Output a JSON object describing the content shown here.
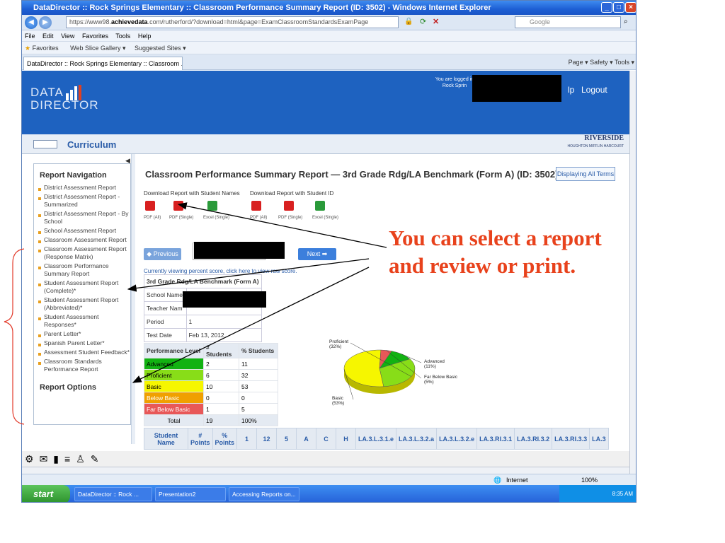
{
  "window": {
    "title": "DataDirector :: Rock Springs Elementary :: Classroom Performance Summary Report (ID: 3502) - Windows Internet Explorer",
    "address_host": "https://www98.",
    "address_bold": "achievedata",
    "address_rest": ".com/rutherford/?download=html&page=ExamClassroomStandardsExamPage",
    "search_placeholder": "Google",
    "menu": [
      "File",
      "Edit",
      "View",
      "Favorites",
      "Tools",
      "Help"
    ],
    "favorites_bar": [
      "Favorites",
      "Web Slice Gallery ▾",
      "Suggested Sites ▾"
    ],
    "tab_title": "DataDirector :: Rock Springs Elementary :: Classroom ...",
    "command_bar": "Page ▾   Safety ▾   Tools ▾"
  },
  "header": {
    "logo_line1": "DATA",
    "logo_line2": "DIRECTOR",
    "logged_in_line1": "You are logged in",
    "logged_in_line2": "Rock Sprin",
    "help_fragment": "lp",
    "logout": "Logout"
  },
  "section_bar": {
    "label": "Curriculum",
    "brand_name": "RIVERSIDE",
    "brand_sub": "HOUGHTON MIFFLIN HARCOURT"
  },
  "sidebar": {
    "heading": "Report Navigation",
    "items": [
      "District Assessment Report",
      "District Assessment Report - Summarized",
      "District Assessment Report - By School",
      "School Assessment Report",
      "Classroom Assessment Report",
      "Classroom Assessment Report (Response Matrix)",
      "Classroom Performance Summary Report",
      "Student Assessment Report (Complete)*",
      "Student Assessment Report (Abbreviated)*",
      "Student Assessment Responses*",
      "Parent Letter*",
      "Spanish Parent Letter*",
      "Assessment Student Feedback*",
      "Classroom Standards Performance Report"
    ],
    "options_heading": "Report Options"
  },
  "report": {
    "title": "Classroom Performance Summary Report — 3rd Grade Rdg/LA Benchmark (Form A) (ID: 3502)",
    "displaying_all_terms": "Displaying All Terms",
    "download_names": "Download Report with Student Names",
    "download_ids": "Download Report with Student ID",
    "icon_labels": [
      "PDF (All)",
      "PDF (Single)",
      "Excel (Single)",
      "PDF (All)",
      "PDF (Single)",
      "Excel (Single)"
    ],
    "previous": "Previous",
    "next": "Next",
    "viewing_text": "Currently viewing percent score, click here to view raw score.",
    "info": {
      "exam_name": "3rd Grade Rdg/LA Benchmark (Form A)",
      "school_label": "School Name",
      "teacher_label": "Teacher Nam",
      "period_label": "Period",
      "period_value": "1",
      "date_label": "Test Date",
      "date_value": "Feb 13, 2012"
    },
    "perf_headers": [
      "Performance Level",
      "# Students",
      "% Students"
    ],
    "perf_rows": [
      {
        "level": "Advanced",
        "count": "2",
        "pct": "11",
        "color": "#12b212"
      },
      {
        "level": "Proficient",
        "count": "6",
        "pct": "32",
        "color": "#88dd18"
      },
      {
        "level": "Basic",
        "count": "10",
        "pct": "53",
        "color": "#f6f600"
      },
      {
        "level": "Below Basic",
        "count": "0",
        "pct": "0",
        "color": "#f0a000"
      },
      {
        "level": "Far Below Basic",
        "count": "1",
        "pct": "5",
        "color": "#e85858"
      }
    ],
    "total_label": "Total",
    "total_count": "19",
    "total_pct": "100%",
    "bottom_headers": [
      "Student Name",
      "# Points",
      "% Points",
      "1",
      "12",
      "5",
      "A",
      "C",
      "H",
      "LA.3.L.3.1.e",
      "LA.3.L.3.2.a",
      "LA.3.L.3.2.e",
      "LA.3.RI.3.1",
      "LA.3.RI.3.2",
      "LA.3.RI.3.3",
      "LA.3"
    ]
  },
  "chart_data": {
    "type": "pie",
    "categories": [
      "Advanced",
      "Proficient",
      "Basic",
      "Below Basic",
      "Far Below Basic"
    ],
    "values": [
      11,
      32,
      53,
      0,
      5
    ],
    "labels": [
      "Advanced (11%)",
      "Proficient (32%)",
      "Basic (53%)",
      "",
      "Far Below Basic (5%)"
    ],
    "colors": [
      "#12b212",
      "#88dd18",
      "#f6f600",
      "#f0a000",
      "#e85858"
    ]
  },
  "status": {
    "zone": "Internet",
    "zoom": "100%"
  },
  "taskbar": {
    "start": "start",
    "tasks": [
      "DataDirector :: Rock ...",
      "Presentation2",
      "Accessing Reports on..."
    ],
    "clock": "8:35 AM"
  },
  "callout": "You can select a report and review or print."
}
